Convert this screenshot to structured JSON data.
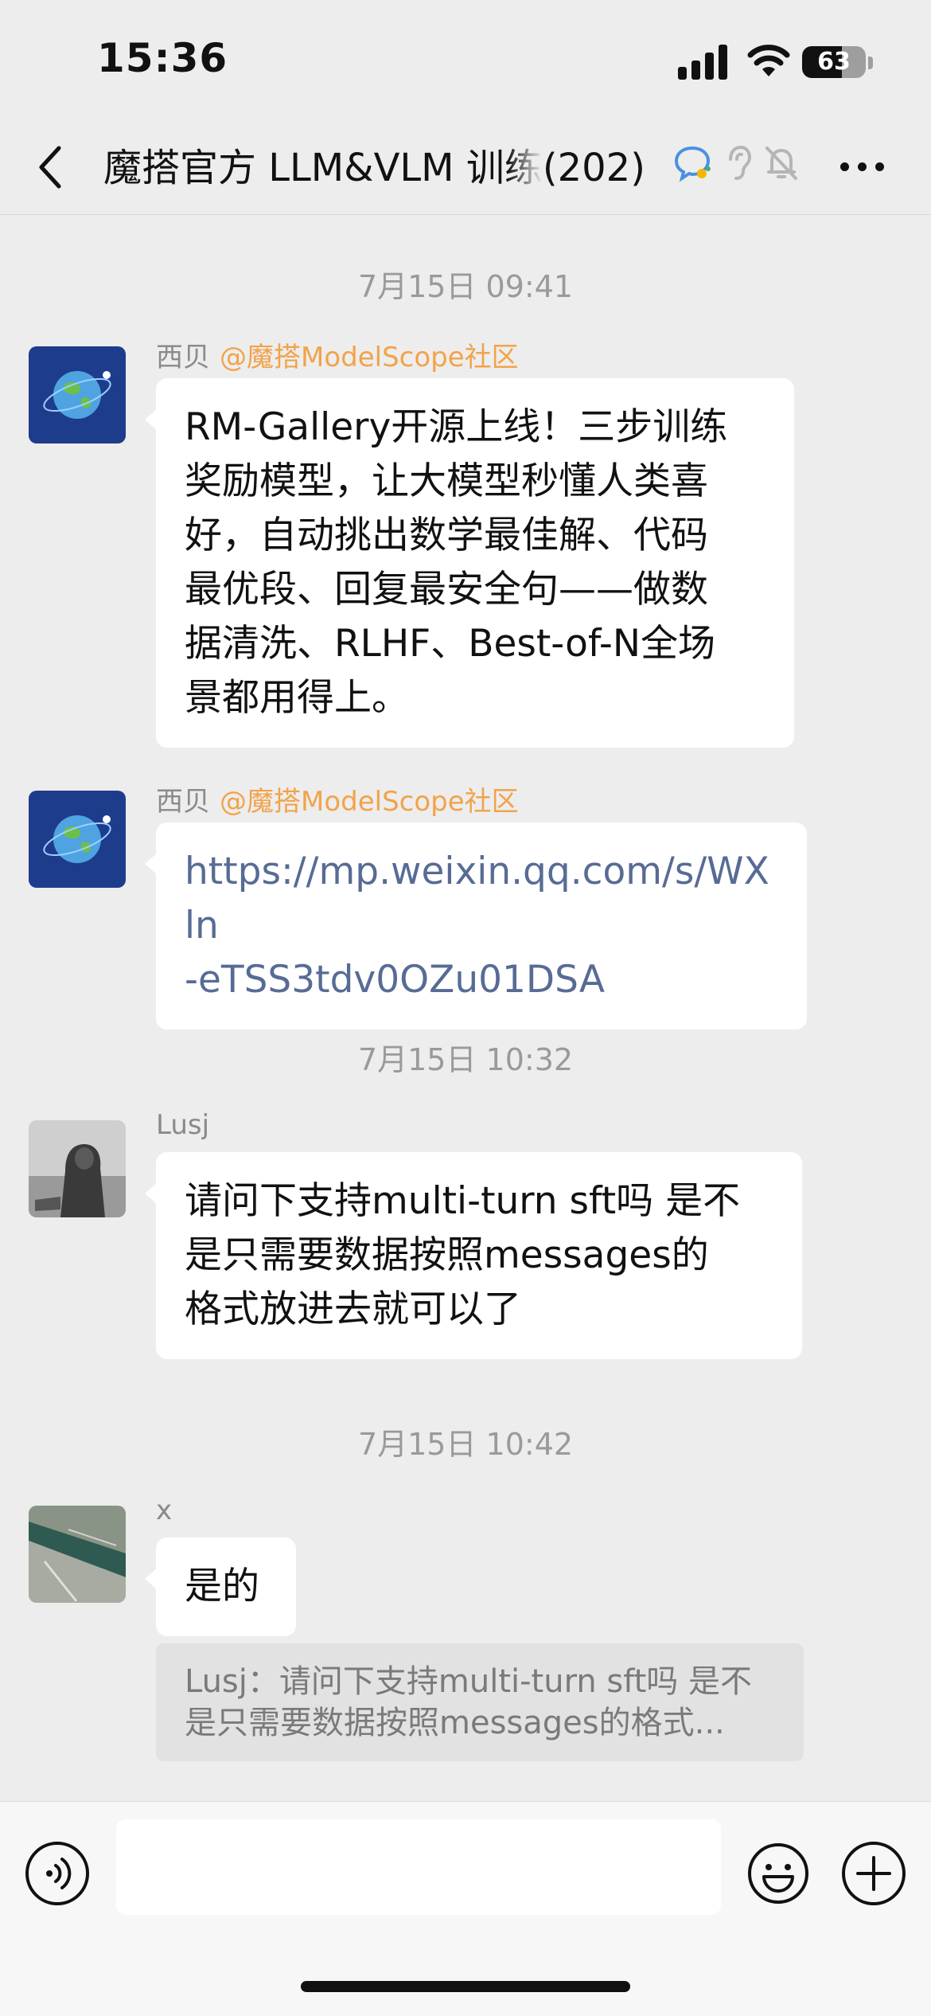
{
  "status_bar": {
    "time": "15:36",
    "battery": "63",
    "battery_level": 0.63,
    "icons": [
      "signal-icon",
      "wifi-icon",
      "battery-icon"
    ]
  },
  "nav": {
    "title": "魔搭官方 LLM&VLM 训练",
    "member_count": "(202)",
    "icons": [
      "back-icon",
      "chat-bubble-icon",
      "ear-icon",
      "mute-bell-icon",
      "more-icon"
    ]
  },
  "messages": [
    {
      "timestamp": "7月15日 09:41",
      "sender": "西贝",
      "mention": "@魔搭ModelScope社区",
      "lines": [
        "RM-Gallery开源上线！三步训练",
        "奖励模型，让大模型秒懂人类喜",
        "好，自动挑出数学最佳解、代码",
        "最优段、回复最安全句——做数",
        "据清洗、RLHF、Best-of-N全场",
        "景都用得上。"
      ]
    },
    {
      "sender": "西贝",
      "mention": "@魔搭ModelScope社区",
      "link_lines": [
        "https://mp.weixin.qq.com/s/WXln",
        "-eTSS3tdv0OZu01DSA"
      ]
    },
    {
      "timestamp": "7月15日 10:32",
      "sender": "Lusj",
      "lines": [
        "请问下支持multi-turn sft吗 是不",
        "是只需要数据按照messages的",
        "格式放进去就可以了"
      ]
    },
    {
      "timestamp": "7月15日 10:42",
      "sender": "x",
      "text": "是的",
      "quote_lines": [
        "Lusj：请问下支持multi-turn sft吗 是不",
        "是只需要数据按照messages的格式..."
      ]
    }
  ],
  "colors": {
    "background": "#ededed",
    "bubble": "#ffffff",
    "mention": "#f2a34a",
    "link": "#576b95",
    "timestamp": "#9a9a9a"
  }
}
